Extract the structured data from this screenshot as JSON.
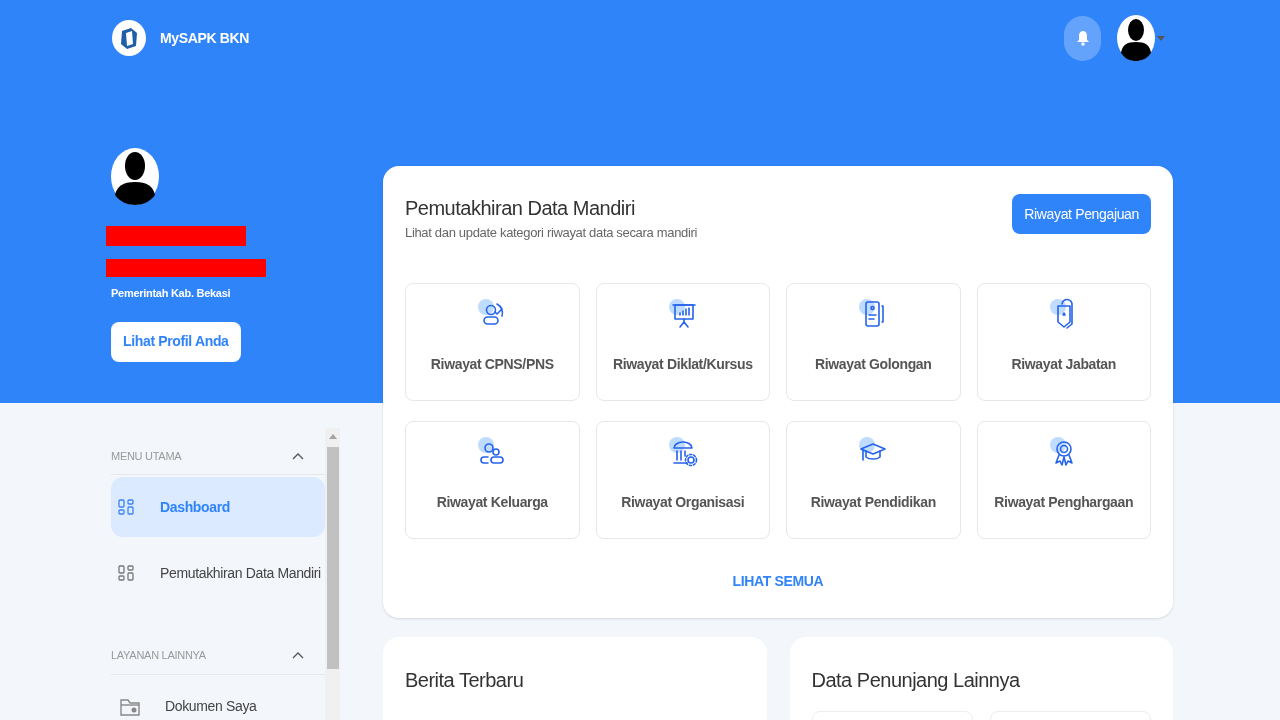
{
  "header": {
    "brand": "MySAPK BKN"
  },
  "profile": {
    "name_redacted": true,
    "id_redacted": true,
    "organization": "Pemerintah Kab. Bekasi",
    "button": "Lihat Profil Anda"
  },
  "sidebar": {
    "sections": [
      {
        "title": "MENU UTAMA",
        "expanded": true,
        "items": [
          {
            "label": "Dashboard",
            "selected": true
          },
          {
            "label": "Pemutakhiran Data Mandiri",
            "selected": false
          }
        ]
      },
      {
        "title": "LAYANAN LAINNYA",
        "expanded": true,
        "items": [
          {
            "label": "Dokumen Saya",
            "selected": false
          }
        ]
      }
    ]
  },
  "main_card": {
    "title": "Pemutakhiran Data Mandiri",
    "subtitle": "Lihat dan update kategori riwayat data secara mandiri",
    "button": "Riwayat Pengajuan",
    "categories": [
      {
        "label": "Riwayat CPNS/PNS"
      },
      {
        "label": "Riwayat Diklat/Kursus"
      },
      {
        "label": "Riwayat Golongan"
      },
      {
        "label": "Riwayat Jabatan"
      },
      {
        "label": "Riwayat Keluarga"
      },
      {
        "label": "Riwayat Organisasi"
      },
      {
        "label": "Riwayat Pendidikan"
      },
      {
        "label": "Riwayat Penghargaan"
      }
    ],
    "link": "LIHAT SEMUA"
  },
  "news_card": {
    "title": "Berita Terbaru"
  },
  "extra_card": {
    "title": "Data Penunjang Lainnya"
  }
}
